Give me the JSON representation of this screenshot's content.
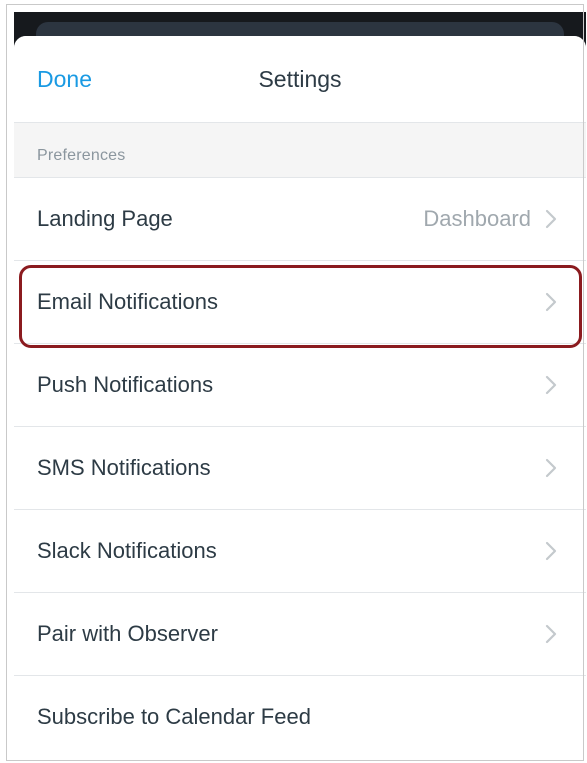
{
  "navbar": {
    "done_label": "Done",
    "title": "Settings"
  },
  "section": {
    "header": "Preferences"
  },
  "rows": [
    {
      "label": "Landing Page",
      "value": "Dashboard",
      "chevron": true
    },
    {
      "label": "Email Notifications",
      "value": "",
      "chevron": true,
      "highlighted": true
    },
    {
      "label": "Push Notifications",
      "value": "",
      "chevron": true
    },
    {
      "label": "SMS Notifications",
      "value": "",
      "chevron": true
    },
    {
      "label": "Slack Notifications",
      "value": "",
      "chevron": true
    },
    {
      "label": "Pair with Observer",
      "value": "",
      "chevron": true
    },
    {
      "label": "Subscribe to Calendar Feed",
      "value": "",
      "chevron": false
    }
  ],
  "colors": {
    "accent": "#1a9ae3",
    "highlight_border": "#8b1b1f",
    "text": "#2d3b45",
    "secondary_text": "#a0a8ae",
    "section_bg": "#f5f5f5"
  },
  "icons": {
    "chevron": "chevron-right-icon"
  }
}
